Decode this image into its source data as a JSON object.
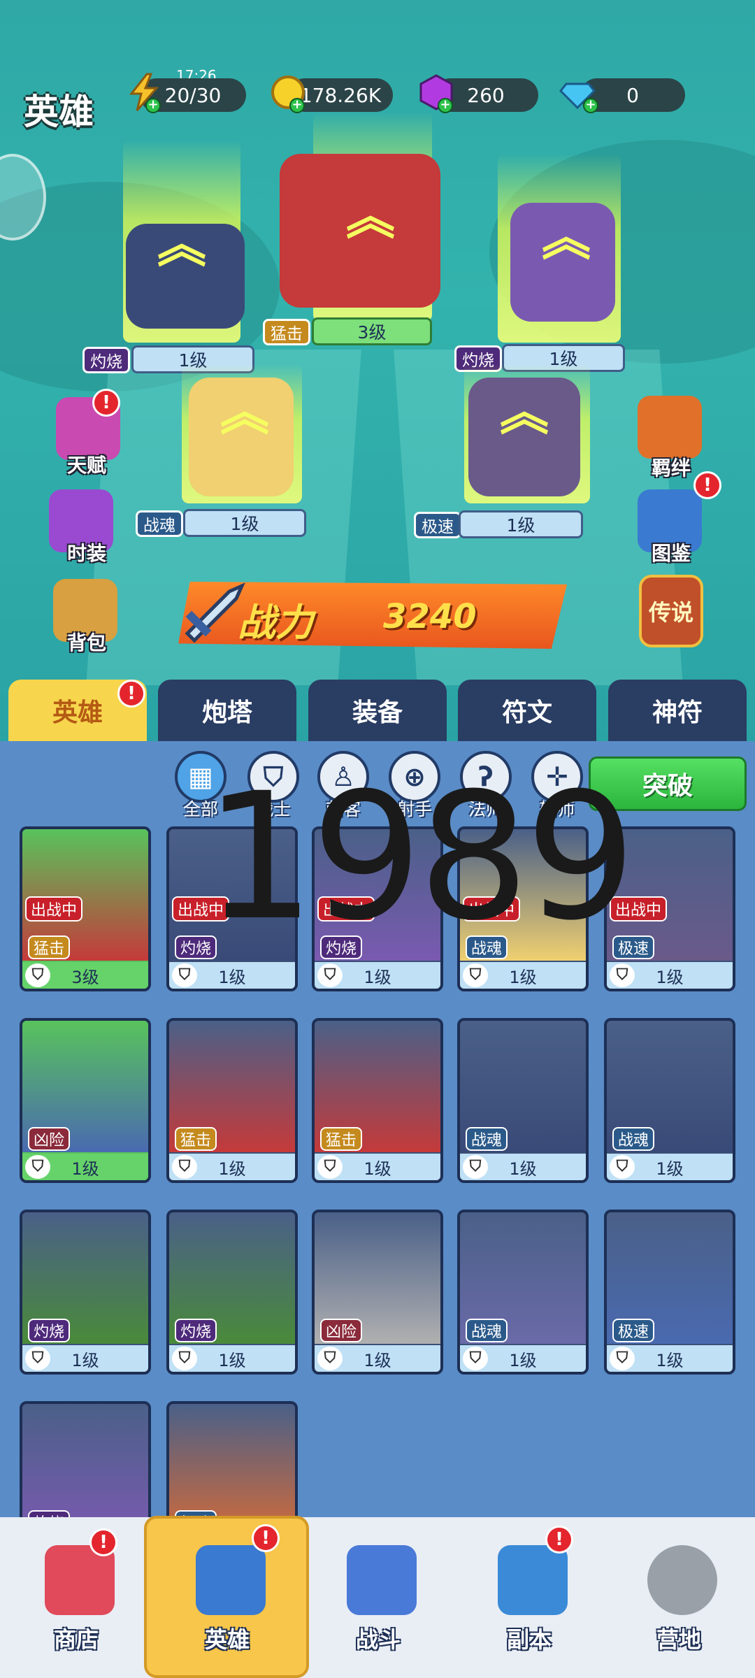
{
  "header": {
    "title": "英雄",
    "clock": "17:26",
    "stamina": "20/30",
    "gold": "178.26K",
    "gems": "260",
    "diamonds": "0"
  },
  "lineup": [
    {
      "tag": "灼烧",
      "level": "1级"
    },
    {
      "tag": "猛击",
      "level": "3级"
    },
    {
      "tag": "灼烧",
      "level": "1级"
    },
    {
      "tag": "战魂",
      "level": "1级"
    },
    {
      "tag": "极速",
      "level": "1级"
    }
  ],
  "side_left": [
    "天赋",
    "时装",
    "背包"
  ],
  "side_right": [
    "羁绊",
    "图鉴",
    "传说"
  ],
  "power": {
    "label": "战力",
    "value": "3240"
  },
  "tabs": [
    "英雄",
    "炮塔",
    "装备",
    "符文",
    "神符"
  ],
  "filters": [
    "全部",
    "战士",
    "刺客",
    "射手",
    "法师",
    "辅师"
  ],
  "break_button": "突破",
  "watermark": "1989",
  "status_deployed": "出战中",
  "cards": [
    {
      "tag": "猛击",
      "level": "3级",
      "deployed": true,
      "green": true
    },
    {
      "tag": "灼烧",
      "level": "1级",
      "deployed": true,
      "green": false
    },
    {
      "tag": "灼烧",
      "level": "1级",
      "deployed": true,
      "green": false
    },
    {
      "tag": "战魂",
      "level": "1级",
      "deployed": true,
      "green": false
    },
    {
      "tag": "极速",
      "level": "1级",
      "deployed": true,
      "green": false
    },
    {
      "tag": "凶险",
      "level": "1级",
      "deployed": false,
      "green": true
    },
    {
      "tag": "猛击",
      "level": "1级",
      "deployed": false,
      "green": false
    },
    {
      "tag": "猛击",
      "level": "1级",
      "deployed": false,
      "green": false
    },
    {
      "tag": "战魂",
      "level": "1级",
      "deployed": false,
      "green": false
    },
    {
      "tag": "战魂",
      "level": "1级",
      "deployed": false,
      "green": false
    },
    {
      "tag": "灼烧",
      "level": "1级",
      "deployed": false,
      "green": false
    },
    {
      "tag": "灼烧",
      "level": "1级",
      "deployed": false,
      "green": false
    },
    {
      "tag": "凶险",
      "level": "1级",
      "deployed": false,
      "green": false
    },
    {
      "tag": "战魂",
      "level": "1级",
      "deployed": false,
      "green": false
    },
    {
      "tag": "极速",
      "level": "1级",
      "deployed": false,
      "green": false
    },
    {
      "tag": "灼烧",
      "level": "",
      "deployed": false,
      "green": false
    },
    {
      "tag": "极速",
      "level": "",
      "deployed": false,
      "green": false
    }
  ],
  "nav": [
    "商店",
    "英雄",
    "战斗",
    "副本",
    "营地"
  ],
  "colors": {
    "accent": "#f7d64d",
    "green_button": "#2bb53d",
    "badge": "#e4252d",
    "panel": "#5a8cc7"
  }
}
